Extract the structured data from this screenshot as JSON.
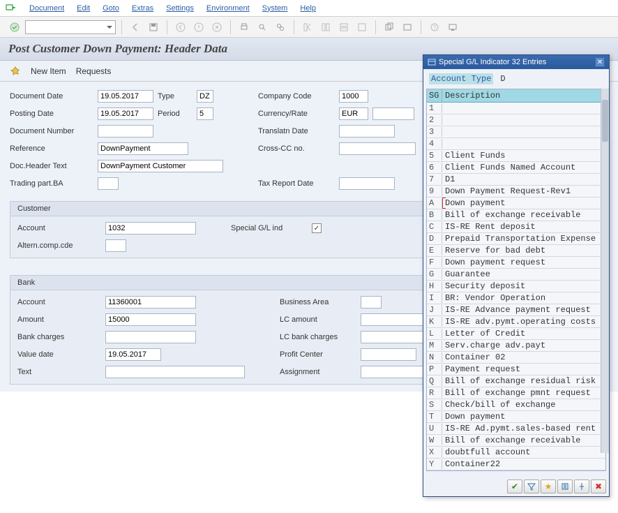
{
  "menu": {
    "items": [
      "Document",
      "Edit",
      "Goto",
      "Extras",
      "Settings",
      "Environment",
      "System",
      "Help"
    ]
  },
  "page_title": "Post Customer Down Payment: Header Data",
  "actions": {
    "new_item": "New Item",
    "requests": "Requests"
  },
  "form": {
    "document_date_label": "Document Date",
    "document_date": "19.05.2017",
    "type_label": "Type",
    "type": "DZ",
    "posting_date_label": "Posting Date",
    "posting_date": "19.05.2017",
    "period_label": "Period",
    "period": "5",
    "document_number_label": "Document Number",
    "document_number": "",
    "reference_label": "Reference",
    "reference": "DownPayment",
    "doc_header_text_label": "Doc.Header Text",
    "doc_header_text": "DownPayment Customer",
    "trading_part_ba_label": "Trading part.BA",
    "trading_part_ba": "",
    "company_code_label": "Company Code",
    "company_code": "1000",
    "currency_rate_label": "Currency/Rate",
    "currency": "EUR",
    "rate": "",
    "translatn_date_label": "Translatn Date",
    "translatn_date": "",
    "cross_cc_no_label": "Cross-CC no.",
    "cross_cc_no": "",
    "tax_report_date_label": "Tax Report Date",
    "tax_report_date": ""
  },
  "customer": {
    "title": "Customer",
    "account_label": "Account",
    "account": "1032",
    "altern_comp_cde_label": "Altern.comp.cde",
    "altern_comp_cde": "",
    "special_gl_ind_label": "Special G/L ind",
    "special_gl_ind_checked": true
  },
  "bank": {
    "title": "Bank",
    "account_label": "Account",
    "account": "11360001",
    "amount_label": "Amount",
    "amount": "15000",
    "bank_charges_label": "Bank charges",
    "bank_charges": "",
    "value_date_label": "Value date",
    "value_date": "19.05.2017",
    "text_label": "Text",
    "text": "",
    "business_area_label": "Business Area",
    "business_area": "",
    "lc_amount_label": "LC amount",
    "lc_amount": "",
    "lc_bank_charges_label": "LC bank charges",
    "lc_bank_charges": "",
    "profit_center_label": "Profit Center",
    "profit_center": "",
    "assignment_label": "Assignment",
    "assignment": ""
  },
  "popup": {
    "title": "Special G/L Indicator 32 Entries",
    "account_type_label": "Account Type",
    "account_type_value": "D",
    "col_sg": "SG",
    "col_desc": "Description",
    "rows": [
      {
        "sg": "1",
        "desc": ""
      },
      {
        "sg": "2",
        "desc": ""
      },
      {
        "sg": "3",
        "desc": ""
      },
      {
        "sg": "4",
        "desc": ""
      },
      {
        "sg": "5",
        "desc": "Client Funds"
      },
      {
        "sg": "6",
        "desc": "Client Funds Named Account"
      },
      {
        "sg": "7",
        "desc": "D1"
      },
      {
        "sg": "9",
        "desc": "Down Payment Request-Rev1"
      },
      {
        "sg": "A",
        "desc": "Down payment",
        "selected": true
      },
      {
        "sg": "B",
        "desc": "Bill of exchange receivable"
      },
      {
        "sg": "C",
        "desc": "IS-RE Rent deposit"
      },
      {
        "sg": "D",
        "desc": "Prepaid Transportation Expense"
      },
      {
        "sg": "E",
        "desc": "Reserve for bad debt"
      },
      {
        "sg": "F",
        "desc": "Down payment request"
      },
      {
        "sg": "G",
        "desc": "Guarantee"
      },
      {
        "sg": "H",
        "desc": "Security deposit"
      },
      {
        "sg": "I",
        "desc": "BR: Vendor Operation"
      },
      {
        "sg": "J",
        "desc": "IS-RE Advance payment request"
      },
      {
        "sg": "K",
        "desc": "IS-RE adv.pymt.operating costs"
      },
      {
        "sg": "L",
        "desc": "Letter of Credit"
      },
      {
        "sg": "M",
        "desc": "Serv.charge adv.payt"
      },
      {
        "sg": "N",
        "desc": "Container 02"
      },
      {
        "sg": "P",
        "desc": "Payment request"
      },
      {
        "sg": "Q",
        "desc": "Bill of exchange residual risk"
      },
      {
        "sg": "R",
        "desc": "Bill of exchange pmnt request"
      },
      {
        "sg": "S",
        "desc": "Check/bill of exchange"
      },
      {
        "sg": "T",
        "desc": "Down payment"
      },
      {
        "sg": "U",
        "desc": "IS-RE Ad.pymt.sales-based rent"
      },
      {
        "sg": "W",
        "desc": "Bill of exchange receivable"
      },
      {
        "sg": "X",
        "desc": "doubtfull account"
      },
      {
        "sg": "Y",
        "desc": "Container22"
      }
    ]
  }
}
